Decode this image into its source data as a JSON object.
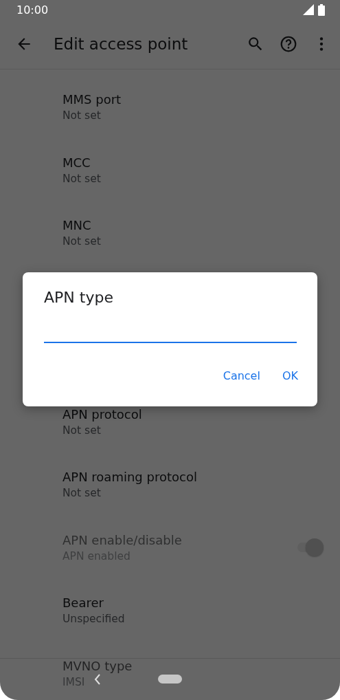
{
  "status_bar": {
    "time": "10:00"
  },
  "app_bar": {
    "title": "Edit access point"
  },
  "settings": {
    "above_dialog": [
      {
        "kind": "text",
        "title": "MMS port",
        "summary": "Not set",
        "disabled": false
      },
      {
        "kind": "text",
        "title": "MCC",
        "summary": "Not set",
        "disabled": false
      },
      {
        "kind": "text",
        "title": "MNC",
        "summary": "Not set",
        "disabled": false
      }
    ],
    "below_dialog": [
      {
        "kind": "text",
        "title": "APN protocol",
        "summary": "Not set",
        "disabled": false
      },
      {
        "kind": "text",
        "title": "APN roaming protocol",
        "summary": "Not set",
        "disabled": false
      },
      {
        "kind": "switch",
        "title": "APN enable/disable",
        "summary": "APN enabled",
        "disabled": true,
        "on": true
      },
      {
        "kind": "text",
        "title": "Bearer",
        "summary": "Unspecified",
        "disabled": false
      },
      {
        "kind": "text",
        "title": "MVNO type",
        "summary": "IMSI",
        "disabled": false
      }
    ]
  },
  "dialog": {
    "title": "APN type",
    "field": {
      "focused": true
    },
    "buttons": [
      "Cancel",
      "OK"
    ]
  }
}
